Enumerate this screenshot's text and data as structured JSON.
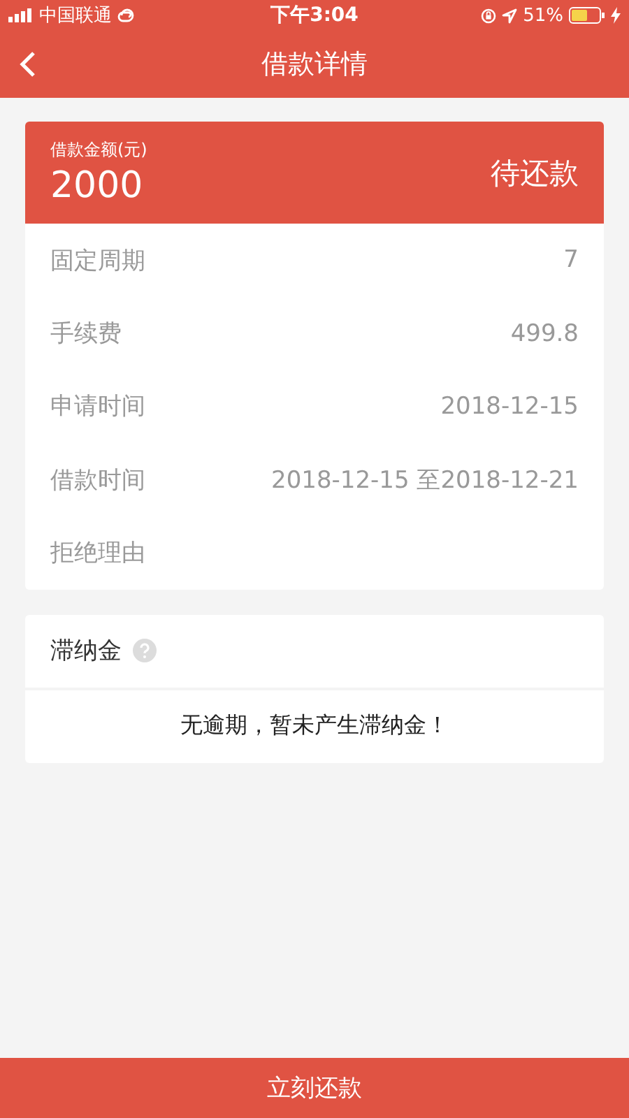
{
  "status_bar": {
    "carrier": "中国联通",
    "time": "下午3:04",
    "battery_percent": "51%"
  },
  "nav": {
    "title": "借款详情"
  },
  "loan": {
    "amount_label": "借款金额(元)",
    "amount": "2000",
    "status": "待还款",
    "rows": [
      {
        "label": "固定周期",
        "value": "7"
      },
      {
        "label": "手续费",
        "value": "499.8"
      },
      {
        "label": "申请时间",
        "value": "2018-12-15"
      },
      {
        "label": "借款时间",
        "value": "2018-12-15 至2018-12-21"
      },
      {
        "label": "拒绝理由"
      }
    ]
  },
  "late_fee": {
    "title": "滞纳金",
    "message": "无逾期，暂未产生滞纳金！"
  },
  "repay_button": "立刻还款"
}
